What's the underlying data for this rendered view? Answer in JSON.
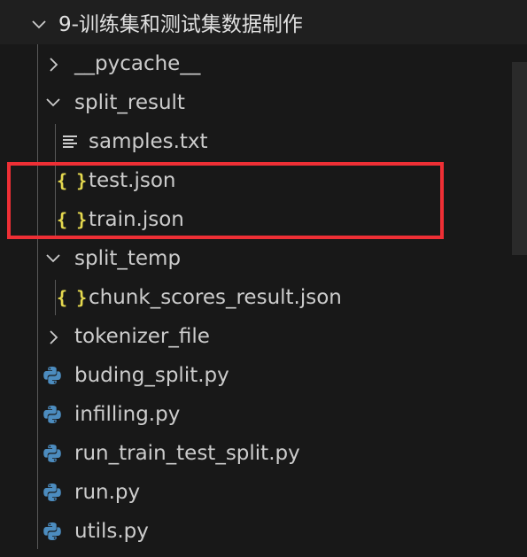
{
  "explorer": {
    "root_folder": {
      "label": "9-训练集和测试集数据制作",
      "expanded": true
    },
    "items": [
      {
        "label": "__pycache__",
        "type": "folder",
        "expanded": false,
        "icon": "chevron-right-icon"
      },
      {
        "label": "split_result",
        "type": "folder",
        "expanded": true,
        "icon": "chevron-down-icon"
      },
      {
        "label": "samples.txt",
        "type": "file",
        "icon": "text-file-icon"
      },
      {
        "label": "test.json",
        "type": "file",
        "icon": "json-braces-icon",
        "icon_text": "{ }"
      },
      {
        "label": "train.json",
        "type": "file",
        "icon": "json-braces-icon",
        "icon_text": "{ }"
      },
      {
        "label": "split_temp",
        "type": "folder",
        "expanded": true,
        "icon": "chevron-down-icon"
      },
      {
        "label": "chunk_scores_result.json",
        "type": "file",
        "icon": "json-braces-icon",
        "icon_text": "{ }"
      },
      {
        "label": "tokenizer_file",
        "type": "folder",
        "expanded": false,
        "icon": "chevron-right-icon"
      },
      {
        "label": "buding_split.py",
        "type": "file",
        "icon": "python-icon"
      },
      {
        "label": "infilling.py",
        "type": "file",
        "icon": "python-icon"
      },
      {
        "label": "run_train_test_split.py",
        "type": "file",
        "icon": "python-icon"
      },
      {
        "label": "run.py",
        "type": "file",
        "icon": "python-icon"
      },
      {
        "label": "utils.py",
        "type": "file",
        "icon": "python-icon"
      }
    ]
  },
  "annotation": {
    "color": "#ee2f35",
    "shape": "rectangle"
  },
  "colors": {
    "background": "#181818",
    "text": "#cccccc",
    "json_icon": "#e5d94f",
    "python_blue": "#4c8cbf",
    "python_yellow": "#f2cc3d"
  }
}
